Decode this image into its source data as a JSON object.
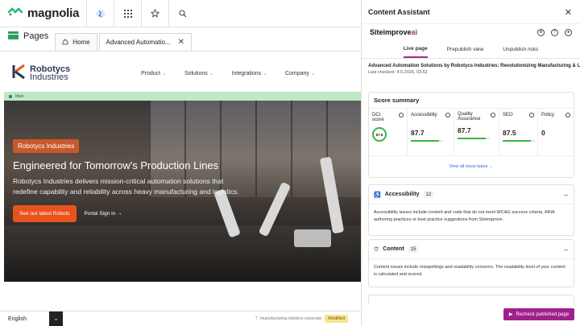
{
  "topbar": {
    "brand": "magnolia",
    "icons": [
      "magnolia-logo-icon",
      "assistant-icon",
      "apps-grid-icon",
      "favorites-star-icon",
      "search-icon"
    ]
  },
  "pages_bar": {
    "app_label": "Pages",
    "tabs": [
      {
        "label": "Home"
      },
      {
        "label": "Advanced Automatio..."
      }
    ]
  },
  "site": {
    "brand_line1": "Robotycs",
    "brand_line2": "Industries",
    "nav": [
      {
        "label": "Product"
      },
      {
        "label": "Solutions"
      },
      {
        "label": "Integrations"
      },
      {
        "label": "Company"
      }
    ],
    "area_badge": "Main",
    "hero": {
      "tag": "Robotycs Industries",
      "title": "Engineered for Tomorrow's Production Lines",
      "text": "Robotycs Industries delivers mission-critical automation solutions that redefine capability and reliability across heavy manufacturing and logistics.",
      "cta_primary": "See our latest Robots",
      "cta_secondary": "Portal Sign in →"
    }
  },
  "bottombar": {
    "language": "English",
    "path": "/manufacturing-robotycs-corporate",
    "status": "Modified"
  },
  "assistant": {
    "title": "Content Assistant",
    "close": "✕",
    "vendor": "Siteimprove",
    "vendor_ai": "ai",
    "tabs": [
      {
        "label": "Live page",
        "active": true
      },
      {
        "label": "Prepublish view"
      },
      {
        "label": "Unpublish risks"
      }
    ],
    "page_title": "Advanced Automation Solutions by Robotycs Industries: Revolutionizing Manufacturing & Lo",
    "last_checked": "Last checked: 4.5.2026, 03:52",
    "score_summary": {
      "title": "Score summary",
      "dci_label": "DCI score",
      "dci_value": "87.6",
      "metrics": [
        {
          "label": "Accessibility",
          "value": "87.7",
          "fill": 0.877
        },
        {
          "label": "Quality Assurance",
          "value": "87.7",
          "fill": 0.877
        },
        {
          "label": "SEO",
          "value": "87.5",
          "fill": 0.875
        },
        {
          "label": "Policy",
          "value": "0",
          "fill": 0
        }
      ],
      "link": "View all issue types →"
    },
    "categories": [
      {
        "title": "Accessibility",
        "count": "12",
        "text": "Accessibility issues include content and code that do not meet WCAG success criteria, ARIA authoring practices or best practice suggestions from Siteimprove."
      },
      {
        "title": "Content",
        "count": "15",
        "text": "Content issues include misspellings and readability concerns. The readability level of your content is calculated and scored."
      }
    ],
    "recheck_button": "Recheck published page"
  }
}
